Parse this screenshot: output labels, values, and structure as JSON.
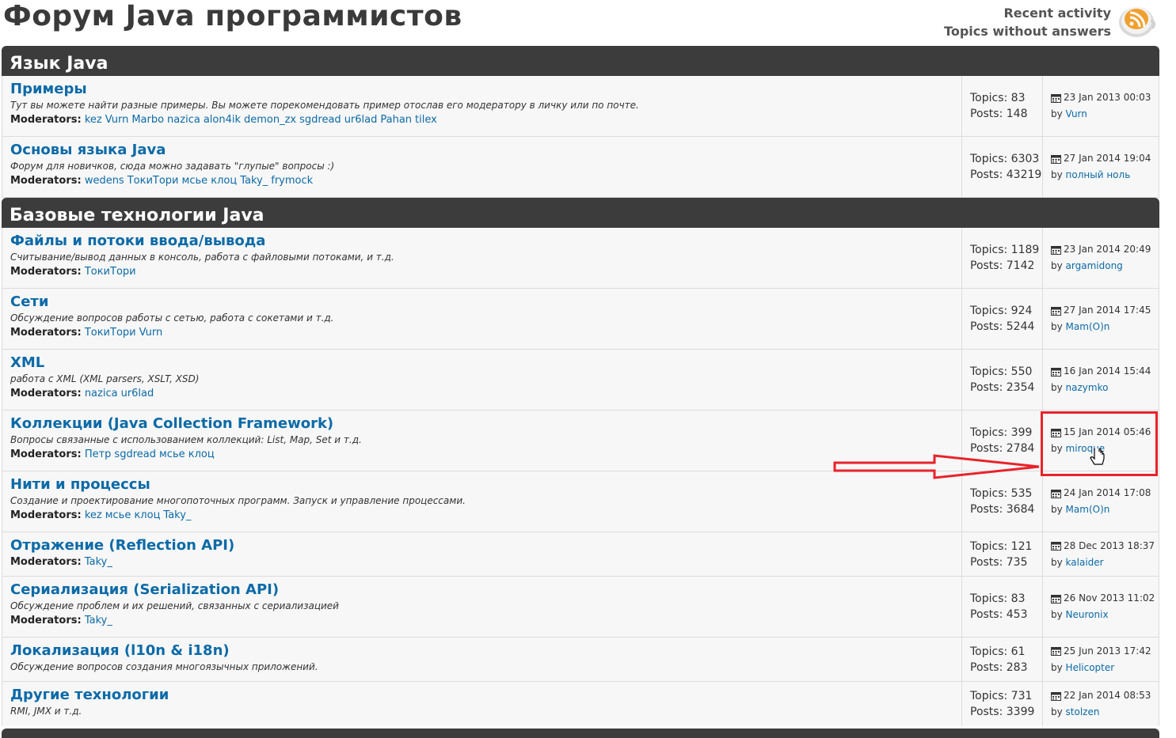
{
  "header": {
    "title": "Форум Java программистов",
    "recent_activity": "Recent activity",
    "topics_without_answers": "Topics without answers",
    "rss_icon": "rss-feed-icon"
  },
  "labels": {
    "moderators": "Moderators:",
    "by": "by"
  },
  "categories": [
    {
      "title": "Язык Java",
      "forums": [
        {
          "name": "Примеры",
          "desc": "Тут вы можете найти разные примеры. Вы можете порекомендовать пример отослав его модератору в личку или по почте.",
          "moderators": [
            "kez",
            "Vurn",
            "Marbo",
            "nazica",
            "alon4ik",
            "demon_zx",
            "sgdread",
            "ur6lad",
            "Pahan",
            "tilex"
          ],
          "topics": "Topics: 83",
          "posts": "Posts: 148",
          "date": "23 Jan 2013 00:03",
          "author": "Vurn"
        },
        {
          "name": "Основы языка Java",
          "desc": "Форум для новичков, сюда можно задавать \"глупые\" вопросы :)",
          "moderators": [
            "wedens",
            "ТокиТори",
            "мсье клоц",
            "Taky_",
            "frymock"
          ],
          "topics": "Topics: 6303",
          "posts": "Posts: 43219",
          "date": "27 Jan 2014 19:04",
          "author": "полный ноль"
        }
      ]
    },
    {
      "title": "Базовые технологии Java",
      "forums": [
        {
          "name": "Файлы и потоки ввода/вывода",
          "desc": "Считывание/вывод данных в консоль, работа с файловыми потоками, и т.д.",
          "moderators": [
            "ТокиТори"
          ],
          "topics": "Topics: 1189",
          "posts": "Posts: 7142",
          "date": "23 Jan 2014 20:49",
          "author": "argamidong"
        },
        {
          "name": "Сети",
          "desc": "Обсуждение вопросов работы с сетью, работа с сокетами и т.д.",
          "moderators": [
            "ТокиТори",
            "Vurn"
          ],
          "topics": "Topics: 924",
          "posts": "Posts: 5244",
          "date": "27 Jan 2014 17:45",
          "author": "Mam(O)n"
        },
        {
          "name": "XML",
          "desc": "работа с XML (XML parsers, XSLT, XSD)",
          "moderators": [
            "nazica",
            "ur6lad"
          ],
          "topics": "Topics: 550",
          "posts": "Posts: 2354",
          "date": "16 Jan 2014 15:44",
          "author": "nazymko"
        },
        {
          "name": "Коллекции (Java Collection Framework)",
          "desc": "Вопросы связанные с использованием коллекций: List, Map, Set и т.д.",
          "moderators": [
            "Петр",
            "sgdread",
            "мсье клоц"
          ],
          "topics": "Topics: 399",
          "posts": "Posts: 2784",
          "date": "15 Jan 2014 05:46",
          "author": "miroque"
        },
        {
          "name": "Нити и процессы",
          "desc": "Создание и проектирование многопоточных программ. Запуск и управление процессами.",
          "moderators": [
            "kez",
            "мсье клоц",
            "Taky_"
          ],
          "topics": "Topics: 535",
          "posts": "Posts: 3684",
          "date": "24 Jan 2014 17:08",
          "author": "Mam(O)n"
        },
        {
          "name": "Отражение (Reflection API)",
          "desc": "",
          "moderators": [
            "Taky_"
          ],
          "topics": "Topics: 121",
          "posts": "Posts: 735",
          "date": "28 Dec 2013 18:37",
          "author": "kalaider"
        },
        {
          "name": "Сериализация (Serialization API)",
          "desc": "Обсуждение проблем и их решений, связанных с сериализацией",
          "moderators": [
            "Taky_"
          ],
          "topics": "Topics: 83",
          "posts": "Posts: 453",
          "date": "26 Nov 2013 11:02",
          "author": "Neuronix"
        },
        {
          "name": "Локализация (l10n & i18n)",
          "desc": "Обсуждение вопросов создания многоязычных приложений.",
          "moderators": [],
          "topics": "Topics: 61",
          "posts": "Posts: 283",
          "date": "25 Jun 2013 17:42",
          "author": "Helicopter"
        },
        {
          "name": "Другие технологии",
          "desc": "RMI, JMX и т.д.",
          "moderators": [],
          "topics": "Topics: 731",
          "posts": "Posts: 3399",
          "date": "22 Jan 2014 08:53",
          "author": "stolzen"
        }
      ]
    }
  ],
  "annotation": {
    "color": "#e8232a"
  }
}
